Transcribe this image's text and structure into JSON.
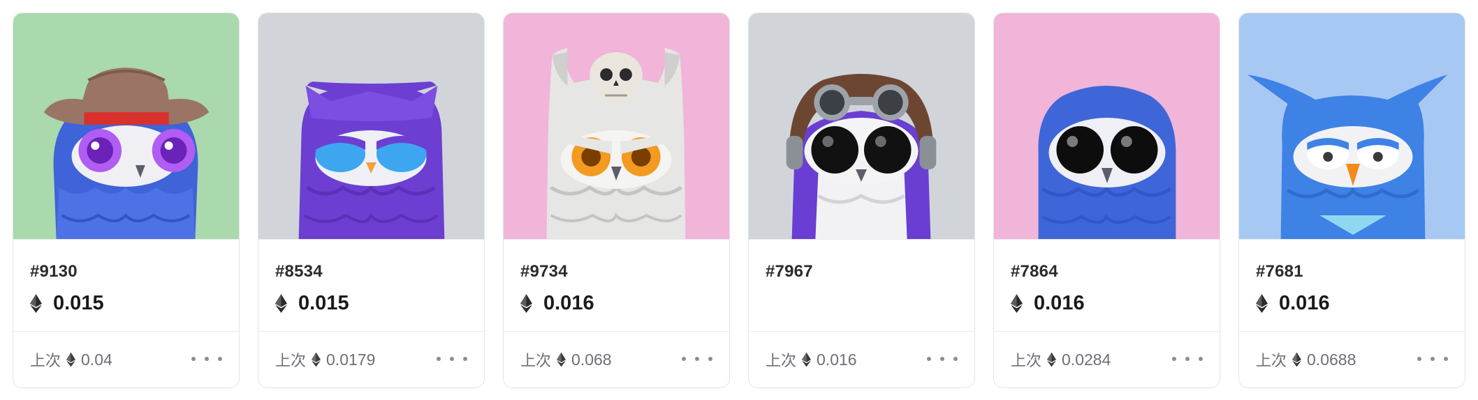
{
  "cards": [
    {
      "token_name": "#9130",
      "price": "0.015",
      "last_label": "上次",
      "last_price": "0.04",
      "background": "#a9d9ad",
      "body_color": "#3f63d8",
      "accessory": "cowboy-hat"
    },
    {
      "token_name": "#8534",
      "price": "0.015",
      "last_label": "上次",
      "last_price": "0.0179",
      "background": "#d1d5da",
      "body_color": "#6c3fd2",
      "accessory": "none"
    },
    {
      "token_name": "#9734",
      "price": "0.016",
      "last_label": "上次",
      "last_price": "0.068",
      "background": "#f0b5d8",
      "body_color": "#e6e6e4",
      "accessory": "skull"
    },
    {
      "token_name": "#7967",
      "price": "",
      "last_label": "上次",
      "last_price": "0.016",
      "background": "#d1d5da",
      "body_color": "#6a3ed2",
      "accessory": "aviator-goggles"
    },
    {
      "token_name": "#7864",
      "price": "0.016",
      "last_label": "上次",
      "last_price": "0.0284",
      "background": "#f0b5d8",
      "body_color": "#3f66d8",
      "accessory": "none"
    },
    {
      "token_name": "#7681",
      "price": "0.016",
      "last_label": "上次",
      "last_price": "0.0688",
      "background": "#a8c8f4",
      "body_color": "#3e82e6",
      "accessory": "none"
    }
  ],
  "icons": {
    "price": "ethereum-icon",
    "menu": "more-horizontal-icon"
  }
}
